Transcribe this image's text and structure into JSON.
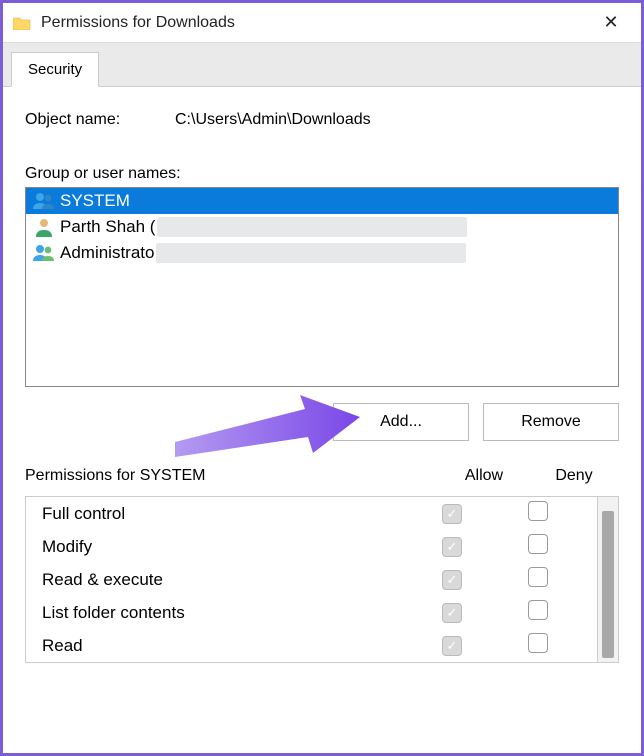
{
  "window": {
    "title": "Permissions for Downloads",
    "close_glyph": "✕"
  },
  "tabs": {
    "security": "Security"
  },
  "object": {
    "label": "Object name:",
    "value": "C:\\Users\\Admin\\Downloads"
  },
  "group": {
    "label": "Group or user names:",
    "items": [
      {
        "name": "SYSTEM",
        "icon": "group",
        "selected": true
      },
      {
        "name": "Parth Shah (",
        "icon": "user",
        "selected": false,
        "redacted": true
      },
      {
        "name": "Administrato",
        "icon": "group",
        "selected": false,
        "redacted": true
      }
    ]
  },
  "buttons": {
    "add": "Add...",
    "remove": "Remove"
  },
  "permissions": {
    "header_label": "Permissions for SYSTEM",
    "allow_label": "Allow",
    "deny_label": "Deny",
    "rows": [
      {
        "name": "Full control",
        "allow": true,
        "allow_disabled": true,
        "deny": false
      },
      {
        "name": "Modify",
        "allow": true,
        "allow_disabled": true,
        "deny": false
      },
      {
        "name": "Read & execute",
        "allow": true,
        "allow_disabled": true,
        "deny": false
      },
      {
        "name": "List folder contents",
        "allow": true,
        "allow_disabled": true,
        "deny": false
      },
      {
        "name": "Read",
        "allow": true,
        "allow_disabled": true,
        "deny": false
      }
    ]
  }
}
